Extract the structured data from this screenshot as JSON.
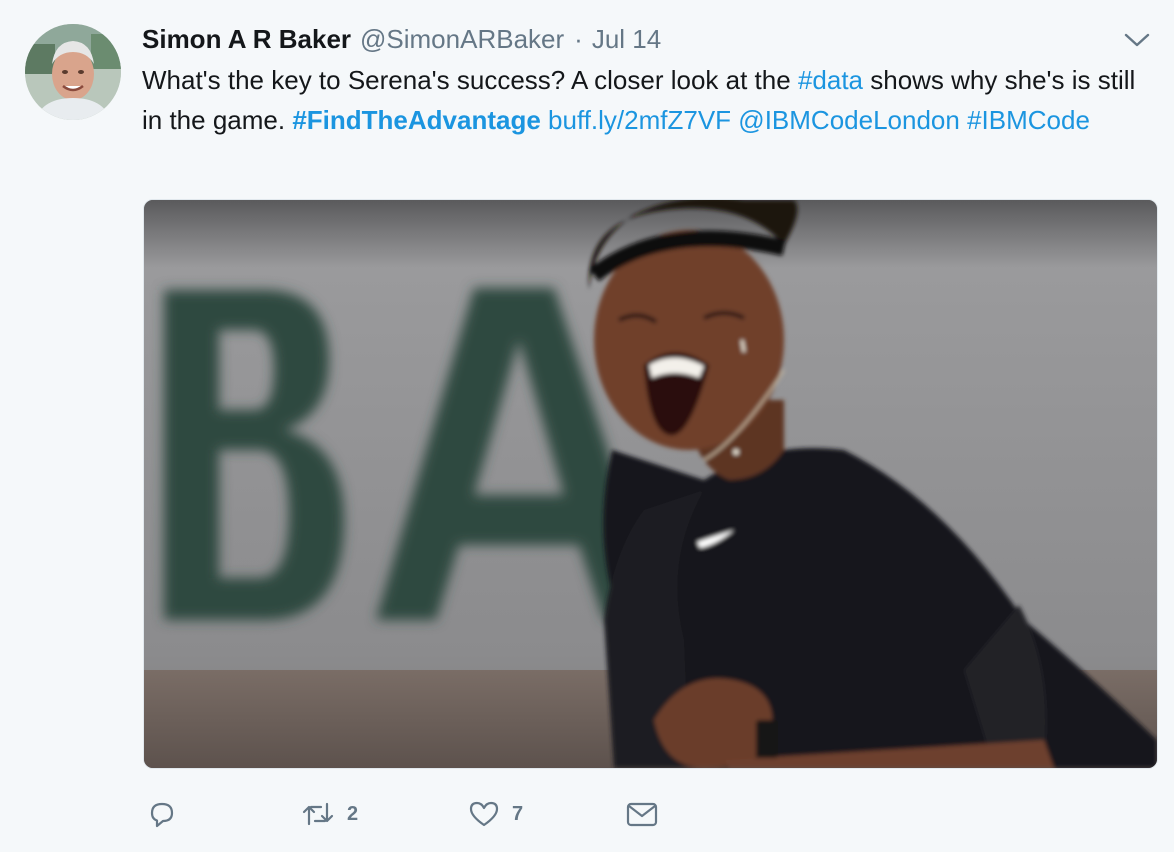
{
  "tweet": {
    "author": {
      "display_name": "Simon A R Baker",
      "handle": "@SimonARBaker",
      "avatar_icon": "profile-photo"
    },
    "separator": "·",
    "date": "Jul 14",
    "menu_icon": "chevron-down-icon",
    "text": {
      "part1": "What's the key to Serena's success? A closer look at the ",
      "hashtag_data": "#data",
      "part2": " shows why she's is still in the game. ",
      "hashtag_findtheadvantage": "#FindTheAdvantage",
      "space1": " ",
      "link": "buff.ly/2mfZ7VF",
      "space2": " ",
      "mention": "@IBMCodeLondon",
      "space3": " ",
      "hashtag_ibmcode": "#IBMCode"
    },
    "media": {
      "kind": "photo",
      "subject": "tennis player celebrating"
    },
    "actions": {
      "reply": {
        "icon": "reply-icon",
        "count": ""
      },
      "retweet": {
        "icon": "retweet-icon",
        "count": "2"
      },
      "like": {
        "icon": "heart-icon",
        "count": "7"
      },
      "dm": {
        "icon": "envelope-icon",
        "count": ""
      }
    }
  },
  "colors": {
    "background": "#f5f8fa",
    "link": "#1b95e0",
    "secondary_text": "#657786",
    "primary_text": "#14171a"
  }
}
